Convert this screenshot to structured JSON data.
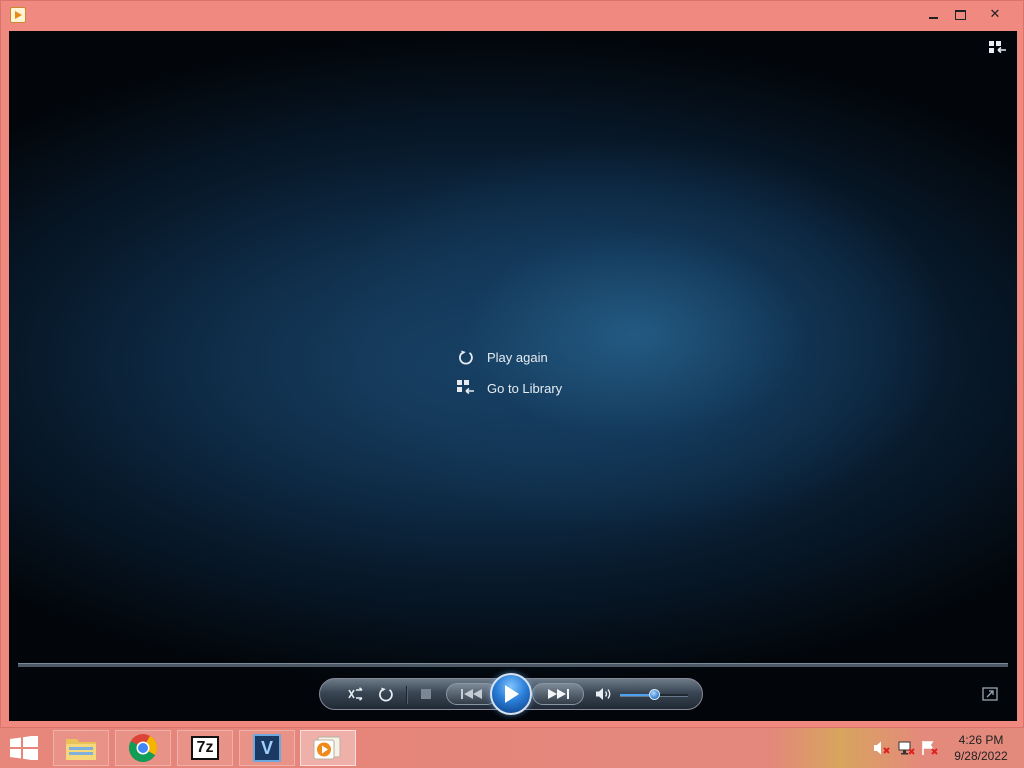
{
  "window": {
    "title": "",
    "icon": "media-player-icon",
    "buttons": {
      "minimize": "minimize-icon",
      "maximize": "maximize-icon",
      "close": "✕"
    }
  },
  "player": {
    "overlay_menu": [
      {
        "label": "Play again",
        "icon": "replay-icon"
      },
      {
        "label": "Go to Library",
        "icon": "library-icon"
      }
    ],
    "volume_level": 0.5,
    "colors": {
      "accent": "#2a7ed8",
      "background": "#10304d"
    }
  },
  "taskbar": {
    "apps": [
      {
        "name": "File Explorer",
        "icon": "folder-icon"
      },
      {
        "name": "Google Chrome",
        "icon": "chrome-icon"
      },
      {
        "name": "7-Zip",
        "icon": "7z-icon",
        "label": "7z"
      },
      {
        "name": "Visual Studio",
        "icon": "v-icon",
        "label": "V"
      },
      {
        "name": "Windows Media Player",
        "icon": "media-player-icon",
        "active": true
      }
    ],
    "clock": {
      "time": "4:26 PM",
      "date": "9/28/2022"
    }
  }
}
